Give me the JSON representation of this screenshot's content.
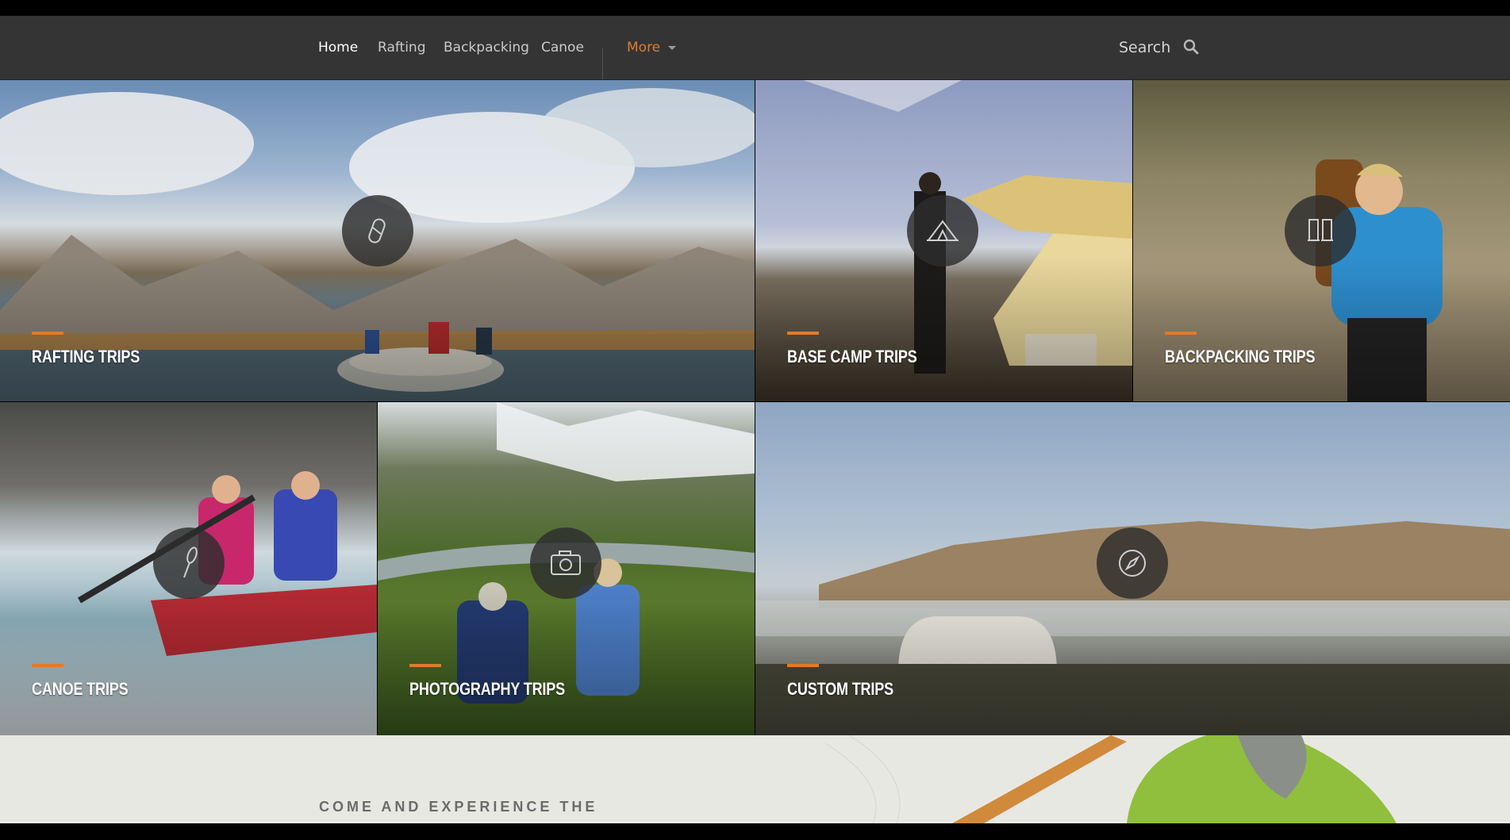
{
  "nav": {
    "items": [
      {
        "label": "Home",
        "active": true
      },
      {
        "label": "Rafting",
        "active": false
      },
      {
        "label": "Backpacking",
        "active": false
      },
      {
        "label": "Canoe",
        "active": false
      }
    ],
    "more_label": "More",
    "search_label": "Search",
    "accent_color": "#e07b2b"
  },
  "tiles": [
    {
      "label": "RAFTING TRIPS",
      "icon": "carabiner-icon"
    },
    {
      "label": "BASE CAMP TRIPS",
      "icon": "tent-icon"
    },
    {
      "label": "BACKPACKING TRIPS",
      "icon": "boots-icon"
    },
    {
      "label": "CANOE TRIPS",
      "icon": "paddle-icon"
    },
    {
      "label": "PHOTOGRAPHY TRIPS",
      "icon": "camera-icon"
    },
    {
      "label": "CUSTOM TRIPS",
      "icon": "compass-icon"
    }
  ],
  "intro": {
    "kicker": "COME AND EXPERIENCE THE"
  }
}
